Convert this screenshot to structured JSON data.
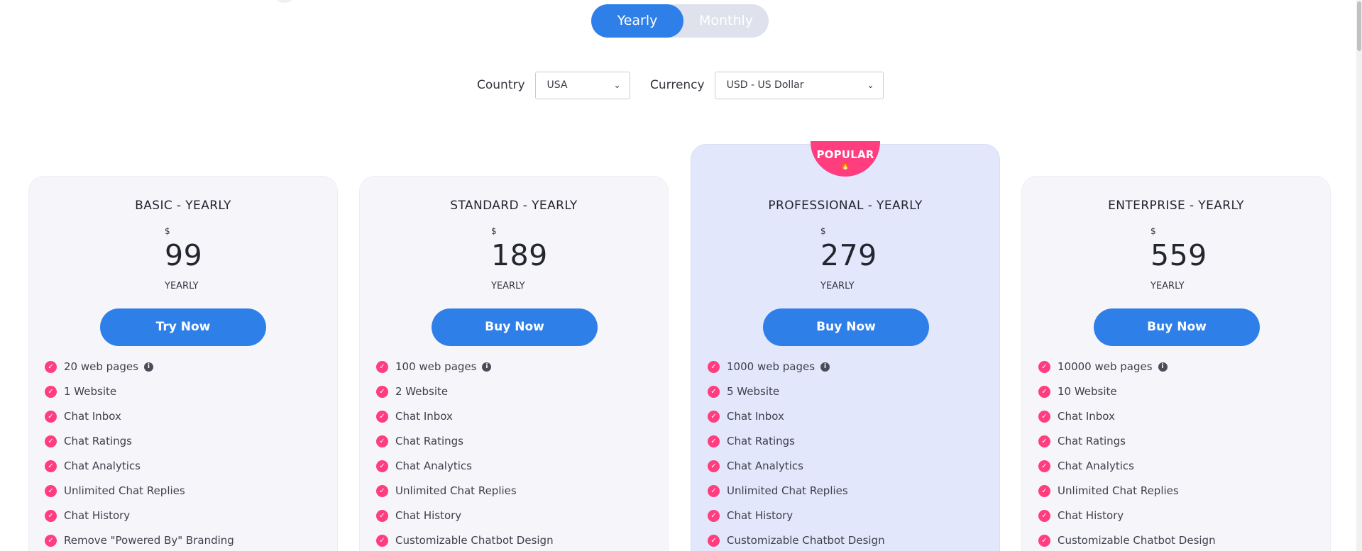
{
  "billing_toggle": {
    "yearly_label": "Yearly",
    "monthly_label": "Monthly",
    "selected": "Yearly"
  },
  "filters": {
    "country_label": "Country",
    "country_value": "USA",
    "currency_label": "Currency",
    "currency_value": "USD - US Dollar"
  },
  "popular_badge": {
    "label": "POPULAR",
    "icon": "flame-icon"
  },
  "colors": {
    "accent": "#2f7fe8",
    "badge": "#ff3d7f",
    "popular_bg": "#e3e7fb",
    "card_bg": "#f6f6fa"
  },
  "plans": [
    {
      "title": "BASIC - YEARLY",
      "currency": "$",
      "price": "99",
      "period": "YEARLY",
      "cta": "Try Now",
      "features": [
        "20 web pages",
        "1 Website",
        "Chat Inbox",
        "Chat Ratings",
        "Chat Analytics",
        "Unlimited Chat Replies",
        "Chat History",
        "Remove \"Powered By\" Branding"
      ]
    },
    {
      "title": "STANDARD - YEARLY",
      "currency": "$",
      "price": "189",
      "period": "YEARLY",
      "cta": "Buy Now",
      "features": [
        "100 web pages",
        "2 Website",
        "Chat Inbox",
        "Chat Ratings",
        "Chat Analytics",
        "Unlimited Chat Replies",
        "Chat History",
        "Customizable Chatbot Design"
      ]
    },
    {
      "title": "PROFESSIONAL - YEARLY",
      "currency": "$",
      "price": "279",
      "period": "YEARLY",
      "cta": "Buy Now",
      "features": [
        "1000 web pages",
        "5 Website",
        "Chat Inbox",
        "Chat Ratings",
        "Chat Analytics",
        "Unlimited Chat Replies",
        "Chat History",
        "Customizable Chatbot Design"
      ]
    },
    {
      "title": "ENTERPRISE - YEARLY",
      "currency": "$",
      "price": "559",
      "period": "YEARLY",
      "cta": "Buy Now",
      "features": [
        "10000 web pages",
        "10 Website",
        "Chat Inbox",
        "Chat Ratings",
        "Chat Analytics",
        "Unlimited Chat Replies",
        "Chat History",
        "Customizable Chatbot Design"
      ]
    }
  ]
}
